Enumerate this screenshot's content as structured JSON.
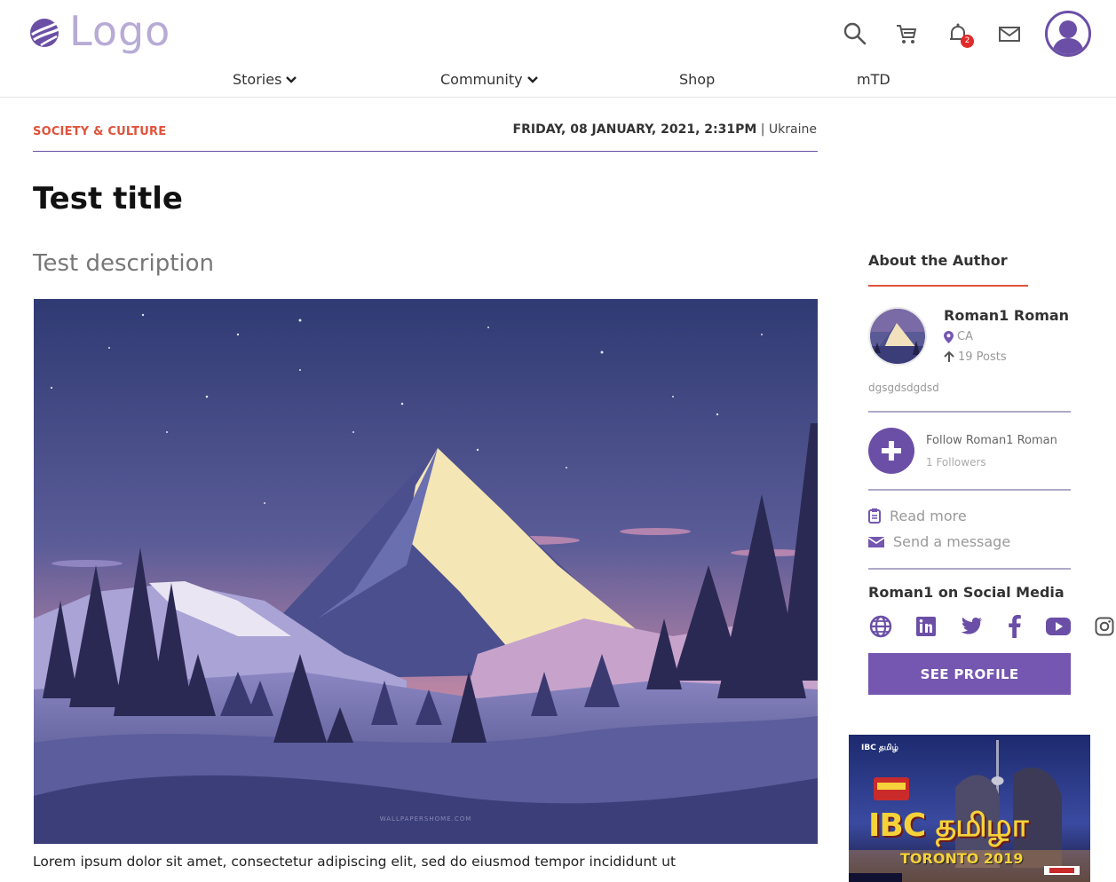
{
  "header": {
    "logo_text": "Logo",
    "notification_count": "2",
    "nav": [
      {
        "label": "Stories",
        "has_dropdown": true
      },
      {
        "label": "Community",
        "has_dropdown": true
      },
      {
        "label": "Shop",
        "has_dropdown": false
      },
      {
        "label": "mTD",
        "has_dropdown": false
      }
    ],
    "icons": [
      "search-icon",
      "cart-icon",
      "bell-icon",
      "mail-icon",
      "user-avatar-icon"
    ]
  },
  "article": {
    "category": "SOCIETY & CULTURE",
    "date": "FRIDAY, 08 JANUARY, 2021, 2:31PM",
    "date_separator": " | ",
    "location": "Ukraine",
    "title": "Test title",
    "description": "Test description",
    "image_watermark": "WALLPAPERSHOME.COM",
    "body_start": "Lorem ipsum dolor sit amet, consectetur adipiscing elit, sed do eiusmod tempor incididunt ut"
  },
  "sidebar": {
    "heading": "About the Author",
    "author_name": "Roman1 Roman",
    "author_location": "CA",
    "author_posts": "19 Posts",
    "author_bio": "dgsgdsdgdsd",
    "follow_label": "Follow Roman1 Roman",
    "followers": "1 Followers",
    "read_more": "Read more",
    "send_message": "Send a message",
    "social_heading": "Roman1 on Social Media",
    "social_icons": [
      "globe-icon",
      "linkedin-icon",
      "twitter-icon",
      "facebook-icon",
      "youtube-icon",
      "instagram-icon"
    ],
    "see_profile": "SEE PROFILE"
  },
  "ad": {
    "small_text": "IBC தமிழ்",
    "main_text": "IBC தமிழா",
    "sub_text": "TORONTO 2019"
  },
  "colors": {
    "brand_purple": "#6b4fa6",
    "accent_red": "#e0533b",
    "button_purple": "#7556b0"
  }
}
